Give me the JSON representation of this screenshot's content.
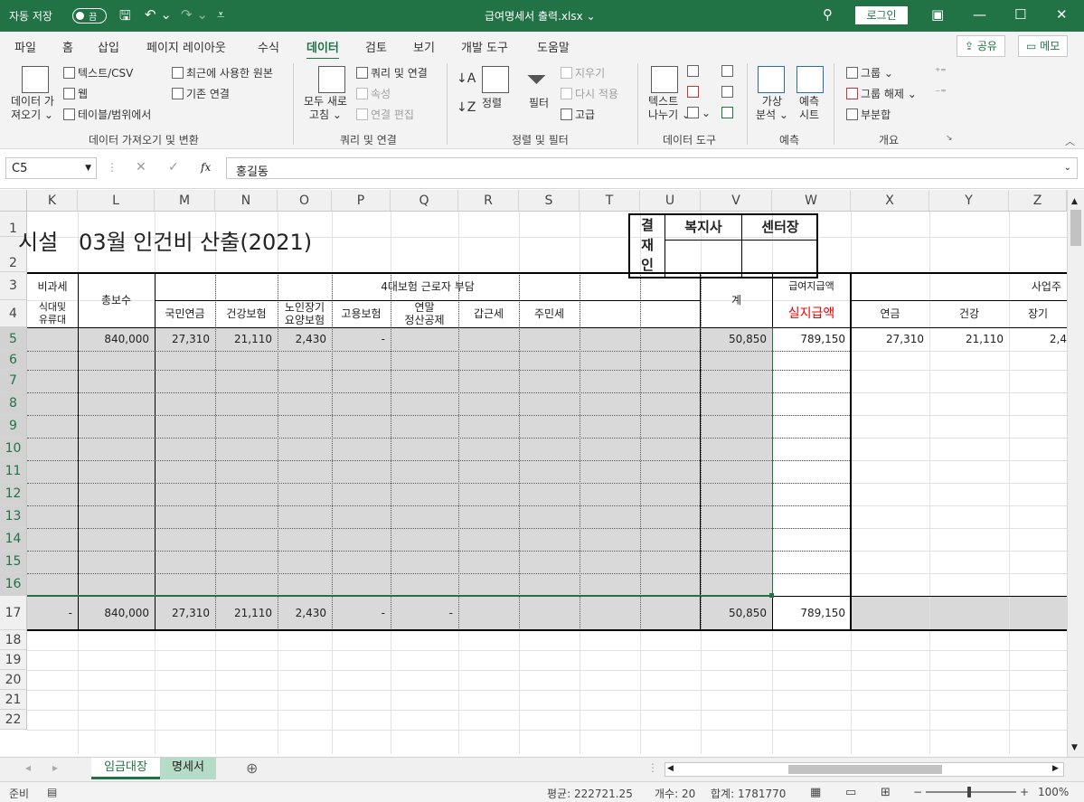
{
  "titlebar": {
    "autosave_label": "자동 저장",
    "autosave_state": "끔",
    "filename": "급여명세서 출력.xlsx ⌄",
    "login": "로그인"
  },
  "menu": {
    "tabs": [
      "파일",
      "홈",
      "삽입",
      "페이지 레이아웃",
      "수식",
      "데이터",
      "검토",
      "보기",
      "개발 도구",
      "도움말"
    ],
    "active": "데이터",
    "share": "공유",
    "memo": "메모"
  },
  "ribbon": {
    "get_data": "데이터 가\n져오기 ⌄",
    "text_csv": "텍스트/CSV",
    "web": "웹",
    "table_range": "테이블/범위에서",
    "recent_sources": "최근에 사용한 원본",
    "existing_conn": "기존 연결",
    "group1": "데이터 가져오기 및 변환",
    "refresh_all": "모두 새로\n고침 ⌄",
    "queries_conn": "쿼리 및 연결",
    "properties": "속성",
    "edit_links": "연결 편집",
    "group2": "쿼리 및 연결",
    "sort": "정렬",
    "filter": "필터",
    "clear": "지우기",
    "reapply": "다시 적용",
    "advanced": "고급",
    "group3": "정렬 및 필터",
    "text_to_cols": "텍스트\n나누기 ⌄",
    "group4": "데이터 도구",
    "whatif": "가상\n분석 ⌄",
    "forecast": "예측\n시트",
    "group5": "예측",
    "group_btn": "그룹 ⌄",
    "ungroup_btn": "그룹 해제 ⌄",
    "subtotal": "부분합",
    "group6": "개요"
  },
  "formula": {
    "namebox": "C5",
    "content": "홍길동"
  },
  "columns": [
    "K",
    "L",
    "M",
    "N",
    "O",
    "P",
    "Q",
    "R",
    "S",
    "T",
    "U",
    "V",
    "W",
    "X",
    "Y",
    "Z"
  ],
  "rows": [
    "1",
    "2",
    "3",
    "4",
    "5",
    "6",
    "7",
    "8",
    "9",
    "10",
    "11",
    "12",
    "13",
    "14",
    "15",
    "16",
    "17",
    "18",
    "19",
    "20",
    "21",
    "22"
  ],
  "sheet": {
    "title": "시설   03월 인건비 산출(2021)",
    "approval": {
      "label": "결\n재\n인",
      "col1": "복지사",
      "col2": "센터장"
    },
    "h_nontax": "비과세",
    "h_meal": "식대및\n유류대",
    "h_total_pay": "총보수",
    "h_insurance": "4대보험 근로자 부담",
    "h_pension": "국민연금",
    "h_health": "건강보험",
    "h_ltc": "노인장기\n요양보험",
    "h_employ": "고용보험",
    "h_yearend": "연말\n정산공제",
    "h_income_tax": "갑근세",
    "h_resident_tax": "주민세",
    "h_sum": "계",
    "h_pay": "급여지급액",
    "h_net": "실지급액",
    "h_employer": "사업주",
    "h_e_pension": "연금",
    "h_e_health": "건강",
    "h_e_ltc": "장기",
    "row5": {
      "total_pay": "840,000",
      "pension": "27,310",
      "health": "21,110",
      "ltc": "2,430",
      "employ": "-",
      "sum": "50,850",
      "net": "789,150",
      "e_pension": "27,310",
      "e_health": "21,110",
      "e_ltc": "2,4"
    },
    "row17": {
      "meal": "-",
      "total_pay": "840,000",
      "pension": "27,310",
      "health": "21,110",
      "ltc": "2,430",
      "employ": "-",
      "yearend": "-",
      "sum": "50,850",
      "net": "789,150"
    }
  },
  "tabs": [
    "임금대장",
    "명세서"
  ],
  "status": {
    "ready": "준비",
    "average": "평균: 222721.25",
    "count": "개수: 20",
    "sum": "합계: 1781770",
    "zoom": "100%"
  }
}
